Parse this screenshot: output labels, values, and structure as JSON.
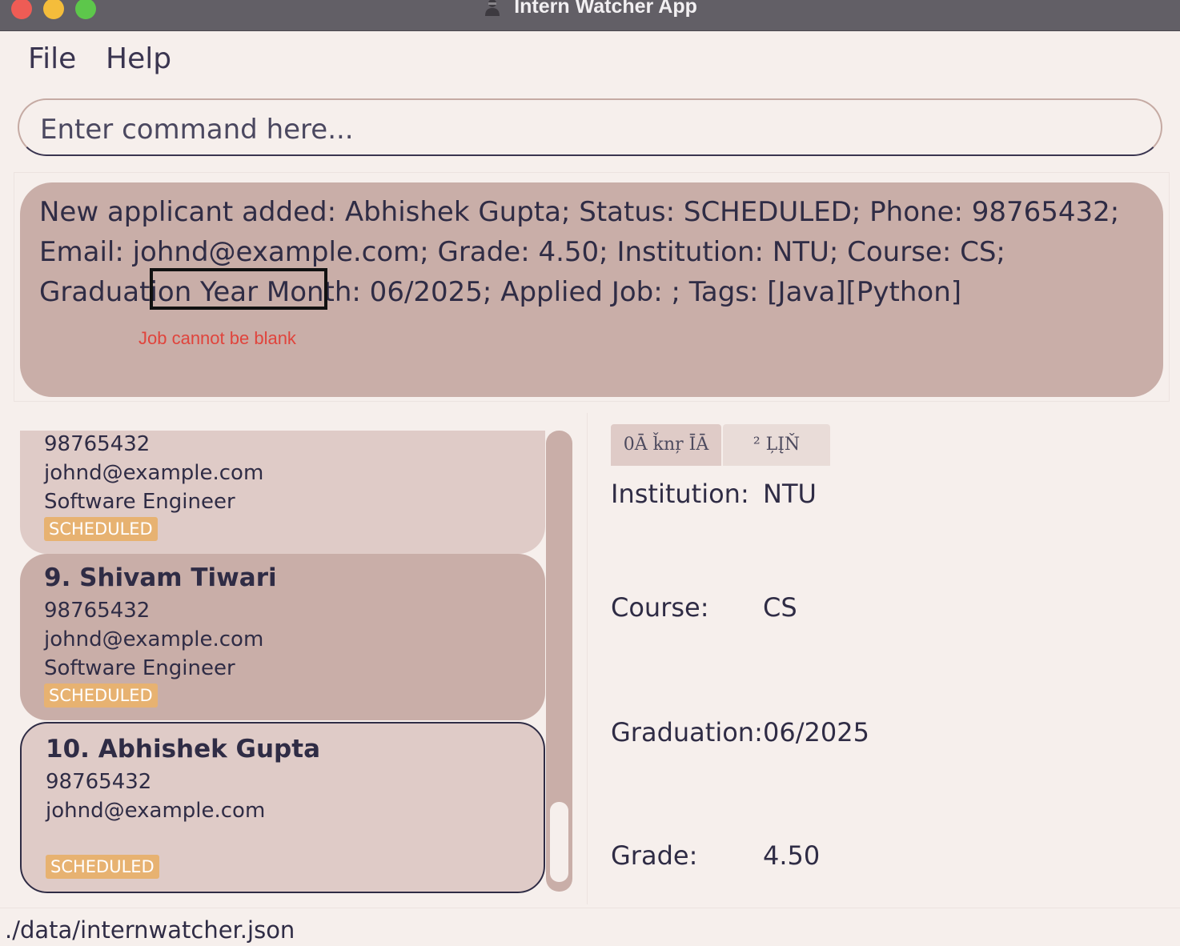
{
  "window": {
    "title": "Intern Watcher App",
    "icon": "person-icon"
  },
  "menu": {
    "file_label": "File",
    "help_label": "Help"
  },
  "command": {
    "placeholder": "Enter command here...",
    "value": ""
  },
  "result": {
    "message": "New applicant added: Abhishek Gupta; Status: SCHEDULED; Phone: 98765432; Email: johnd@example.com; Grade: 4.50; Institution: NTU; Course: CS; Graduation Year Month: 06/2025; Applied Job: ; Tags: [Java][Python]",
    "error": "Job cannot be blank"
  },
  "applicants": [
    {
      "index_name": "",
      "phone": "98765432",
      "email": "johnd@example.com",
      "job": "Software Engineer",
      "status": "SCHEDULED"
    },
    {
      "index_name": "9.  Shivam Tiwari",
      "phone": "98765432",
      "email": "johnd@example.com",
      "job": "Software Engineer",
      "status": "SCHEDULED"
    },
    {
      "index_name": "10.  Abhishek Gupta",
      "phone": "98765432",
      "email": "johnd@example.com",
      "job": "",
      "status": "SCHEDULED"
    }
  ],
  "scroll": {
    "position_fraction": 1.0
  },
  "detail": {
    "tabs": [
      "0Ā ǩnŗ ĪĀ",
      "² ĻĮŇ"
    ],
    "fields": [
      {
        "label": "Institution:",
        "value": "NTU"
      },
      {
        "label": "Course:",
        "value": "CS"
      },
      {
        "label": "Graduation:",
        "value": "06/2025"
      },
      {
        "label": "Grade:",
        "value": "4.50"
      }
    ]
  },
  "status_bar": {
    "path": "./data/internwatcher.json"
  },
  "colors": {
    "accent_badge": "#e7b271",
    "panel": "#c9aea8",
    "card_light": "#dfcbc7",
    "background": "#f6efec",
    "error": "#e0443c",
    "text": "#2f2c45"
  }
}
